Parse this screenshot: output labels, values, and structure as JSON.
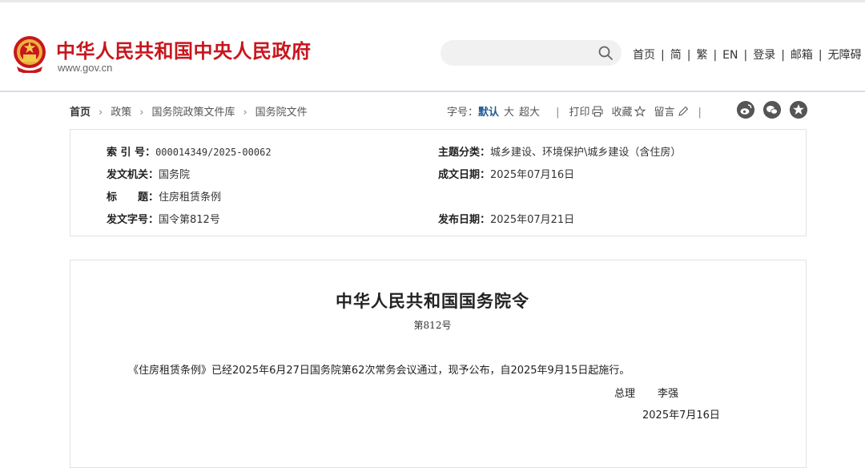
{
  "header": {
    "site_title": "中华人民共和国中央人民政府",
    "site_url": "www.gov.cn",
    "search_placeholder": "",
    "nav": [
      "首页",
      "简",
      "繁",
      "EN",
      "登录",
      "邮箱",
      "无障碍"
    ]
  },
  "breadcrumb": [
    "首页",
    "政策",
    "国务院政策文件库",
    "国务院文件"
  ],
  "toolbar": {
    "font_size_label": "字号：",
    "font_default": "默认",
    "font_large": "大",
    "font_xlarge": "超大",
    "print": "打印",
    "favorite": "收藏",
    "comment": "留言"
  },
  "meta": {
    "index_label": "索 引 号：",
    "index_value": "000014349/2025-00062",
    "topic_label": "主题分类：",
    "topic_value": "城乡建设、环境保护\\城乡建设（含住房）",
    "issuer_label": "发文机关：",
    "issuer_value": "国务院",
    "created_label": "成文日期：",
    "created_value": "2025年07月16日",
    "title_label": "标　　题：",
    "title_value": "住房租赁条例",
    "docno_label": "发文字号：",
    "docno_value": "国令第812号",
    "published_label": "发布日期：",
    "published_value": "2025年07月21日"
  },
  "document": {
    "title": "中华人民共和国国务院令",
    "number": "第812号",
    "body": "《住房租赁条例》已经2025年6月27日国务院第62次常务会议通过，现予公布，自2025年9月15日起施行。",
    "sign_title": "总理",
    "sign_name": "李强",
    "sign_date": "2025年7月16日"
  },
  "colors": {
    "brand_red": "#c8161d",
    "accent_blue": "#1e5a96"
  }
}
